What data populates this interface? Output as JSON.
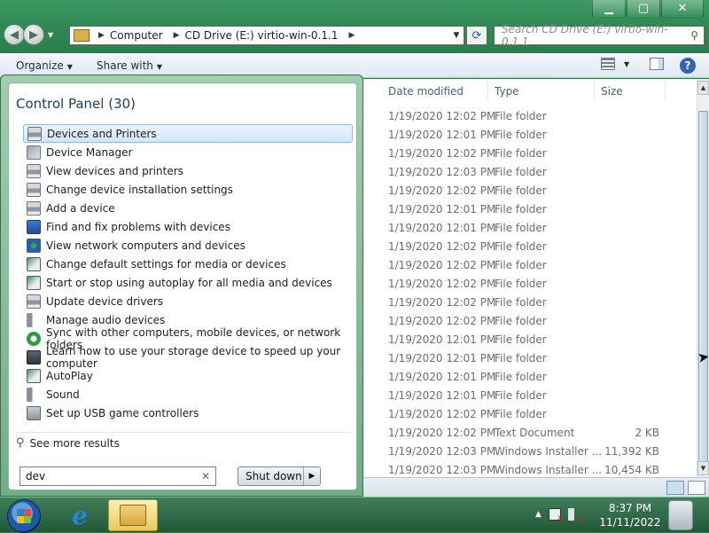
{
  "window": {
    "address_segments": [
      "Computer",
      "CD Drive (E:) virtio-win-0.1.1"
    ],
    "search_placeholder": "Search CD Drive (E:) virtio-win-0.1.1",
    "caption_buttons": [
      "minimize",
      "maximize",
      "close"
    ]
  },
  "toolbar": {
    "organize": "Organize",
    "share_with": "Share with"
  },
  "columns": {
    "date_modified": "Date modified",
    "type": "Type",
    "size": "Size"
  },
  "files": [
    {
      "date": "1/19/2020 12:02 PM",
      "type": "File folder",
      "size": ""
    },
    {
      "date": "1/19/2020 12:01 PM",
      "type": "File folder",
      "size": ""
    },
    {
      "date": "1/19/2020 12:02 PM",
      "type": "File folder",
      "size": ""
    },
    {
      "date": "1/19/2020 12:03 PM",
      "type": "File folder",
      "size": ""
    },
    {
      "date": "1/19/2020 12:02 PM",
      "type": "File folder",
      "size": ""
    },
    {
      "date": "1/19/2020 12:01 PM",
      "type": "File folder",
      "size": ""
    },
    {
      "date": "1/19/2020 12:01 PM",
      "type": "File folder",
      "size": ""
    },
    {
      "date": "1/19/2020 12:02 PM",
      "type": "File folder",
      "size": ""
    },
    {
      "date": "1/19/2020 12:02 PM",
      "type": "File folder",
      "size": ""
    },
    {
      "date": "1/19/2020 12:02 PM",
      "type": "File folder",
      "size": ""
    },
    {
      "date": "1/19/2020 12:02 PM",
      "type": "File folder",
      "size": ""
    },
    {
      "date": "1/19/2020 12:02 PM",
      "type": "File folder",
      "size": ""
    },
    {
      "date": "1/19/2020 12:01 PM",
      "type": "File folder",
      "size": ""
    },
    {
      "date": "1/19/2020 12:01 PM",
      "type": "File folder",
      "size": ""
    },
    {
      "date": "1/19/2020 12:01 PM",
      "type": "File folder",
      "size": ""
    },
    {
      "date": "1/19/2020 12:01 PM",
      "type": "File folder",
      "size": ""
    },
    {
      "date": "1/19/2020 12:02 PM",
      "type": "File folder",
      "size": ""
    },
    {
      "date": "1/19/2020 12:02 PM",
      "type": "Text Document",
      "size": "2 KB"
    },
    {
      "date": "1/19/2020 12:03 PM",
      "type": "Windows Installer ...",
      "size": "11,392 KB"
    },
    {
      "date": "1/19/2020 12:03 PM",
      "type": "Windows Installer ...",
      "size": "10,454 KB"
    }
  ],
  "start_menu": {
    "group_title": "Control Panel (30)",
    "items": [
      {
        "label": "Devices and Printers",
        "icon": "printer-icon",
        "selected": true
      },
      {
        "label": "Device Manager",
        "icon": "device-manager-icon"
      },
      {
        "label": "View devices and printers",
        "icon": "printer-icon"
      },
      {
        "label": "Change device installation settings",
        "icon": "printer-icon"
      },
      {
        "label": "Add a device",
        "icon": "printer-icon"
      },
      {
        "label": "Find and fix problems with devices",
        "icon": "troubleshoot-icon"
      },
      {
        "label": "View network computers and devices",
        "icon": "network-icon"
      },
      {
        "label": "Change default settings for media or devices",
        "icon": "autoplay-icon"
      },
      {
        "label": "Start or stop using autoplay for all media and devices",
        "icon": "autoplay-icon"
      },
      {
        "label": "Update device drivers",
        "icon": "printer-icon"
      },
      {
        "label": "Manage audio devices",
        "icon": "speaker-icon"
      },
      {
        "label": "Sync with other computers, mobile devices, or network folders",
        "icon": "sync-icon"
      },
      {
        "label": "Learn how to use your storage device to speed up your computer",
        "icon": "storage-icon"
      },
      {
        "label": "AutoPlay",
        "icon": "autoplay-icon"
      },
      {
        "label": "Sound",
        "icon": "speaker-icon"
      },
      {
        "label": "Set up USB game controllers",
        "icon": "game-controller-icon"
      }
    ],
    "see_more": "See more results",
    "search_value": "dev",
    "shutdown_label": "Shut down"
  },
  "taskbar": {
    "time": "8:37 PM",
    "date": "11/11/2022"
  }
}
